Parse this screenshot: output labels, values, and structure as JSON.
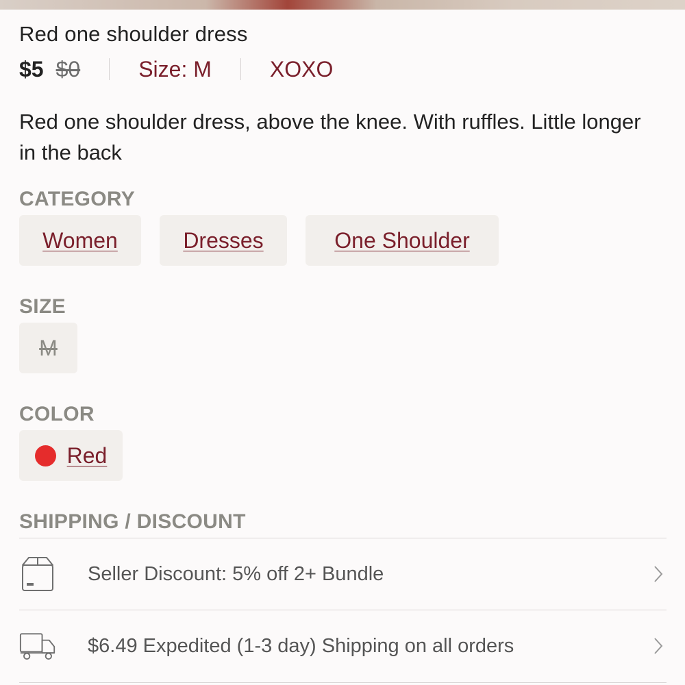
{
  "listing": {
    "title": "Red one shoulder dress",
    "price": "$5",
    "original_price": "$0",
    "size_label": "Size: M",
    "brand": "XOXO",
    "description": "Red one shoulder dress, above the knee. With ruffles. Little longer in the back"
  },
  "category": {
    "heading": "CATEGORY",
    "items": [
      "Women",
      "Dresses",
      "One Shoulder"
    ]
  },
  "size": {
    "heading": "SIZE",
    "value": "M"
  },
  "color": {
    "heading": "COLOR",
    "name": "Red",
    "swatch": "#e52c2c"
  },
  "shipping": {
    "heading": "SHIPPING / DISCOUNT",
    "rows": [
      {
        "text": "Seller Discount: 5% off 2+ Bundle",
        "icon": "box-icon"
      },
      {
        "text": "$6.49 Expedited (1-3 day) Shipping on all orders",
        "icon": "truck-icon"
      }
    ]
  },
  "colors": {
    "accent": "#7a1f2b",
    "label_gray": "#8b8a84",
    "chip_bg": "#f2efec"
  }
}
